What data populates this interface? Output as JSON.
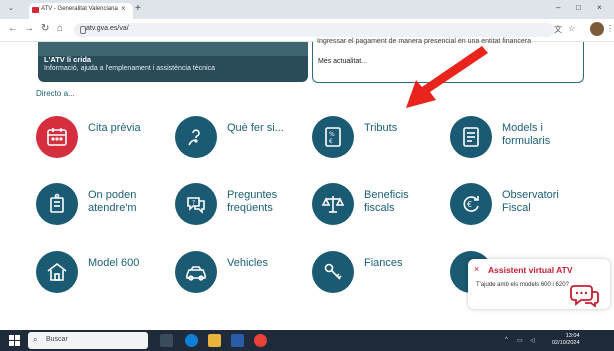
{
  "browser": {
    "tab_title": "ATV - Generalitat Valenciana",
    "new_tab": "+",
    "close_tab": "×",
    "url": "atv.gva.es/va/",
    "window_controls": [
      "–",
      "□",
      "×"
    ]
  },
  "banners": {
    "left_title": "L'ATV li crida",
    "left_subtitle": "Informació, ajuda a l'emplenament i assistència tècnica",
    "right_clipped": "Ingressar el pagament de manera presencial en una entitat financera",
    "right_more": "Més actualitat..."
  },
  "section_title": "Directo a...",
  "tiles": [
    {
      "label": "Cita prèvia",
      "icon": "calendar-icon",
      "accent": "#d42e3f"
    },
    {
      "label": "Què fer si...",
      "icon": "question-hand-icon",
      "accent": "#1a5a72"
    },
    {
      "label": "Tributs",
      "icon": "tax-document-icon",
      "accent": "#1a5a72"
    },
    {
      "label": "Models i formularis",
      "icon": "forms-icon",
      "accent": "#1a5a72"
    },
    {
      "label": "On poden atendre'm",
      "icon": "office-icon",
      "accent": "#1a5a72"
    },
    {
      "label": "Preguntes freqüents",
      "icon": "faq-chat-icon",
      "accent": "#1a5a72"
    },
    {
      "label": "Beneficis fiscals",
      "icon": "scales-icon",
      "accent": "#1a5a72"
    },
    {
      "label": "Observatori Fiscal",
      "icon": "euro-refresh-icon",
      "accent": "#1a5a72"
    },
    {
      "label": "Model 600",
      "icon": "house-icon",
      "accent": "#1a5a72"
    },
    {
      "label": "Vehicles",
      "icon": "car-icon",
      "accent": "#1a5a72"
    },
    {
      "label": "Fiances",
      "icon": "keys-icon",
      "accent": "#1a5a72"
    }
  ],
  "assistant": {
    "title": "Assistent virtual ATV",
    "message": "T'ajude amb els models 600 i 620?",
    "close": "×"
  },
  "taskbar": {
    "search_placeholder": "Buscar",
    "time": "13:04",
    "date": "02/10/2024"
  }
}
